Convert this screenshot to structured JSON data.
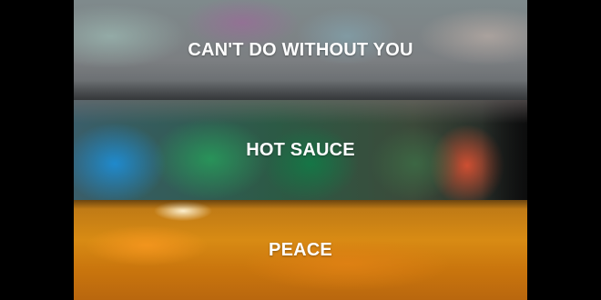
{
  "tiles": [
    {
      "label": "CAN'T DO WITHOUT YOU"
    },
    {
      "label": "HOT SAUCE"
    },
    {
      "label": "PEACE"
    }
  ]
}
